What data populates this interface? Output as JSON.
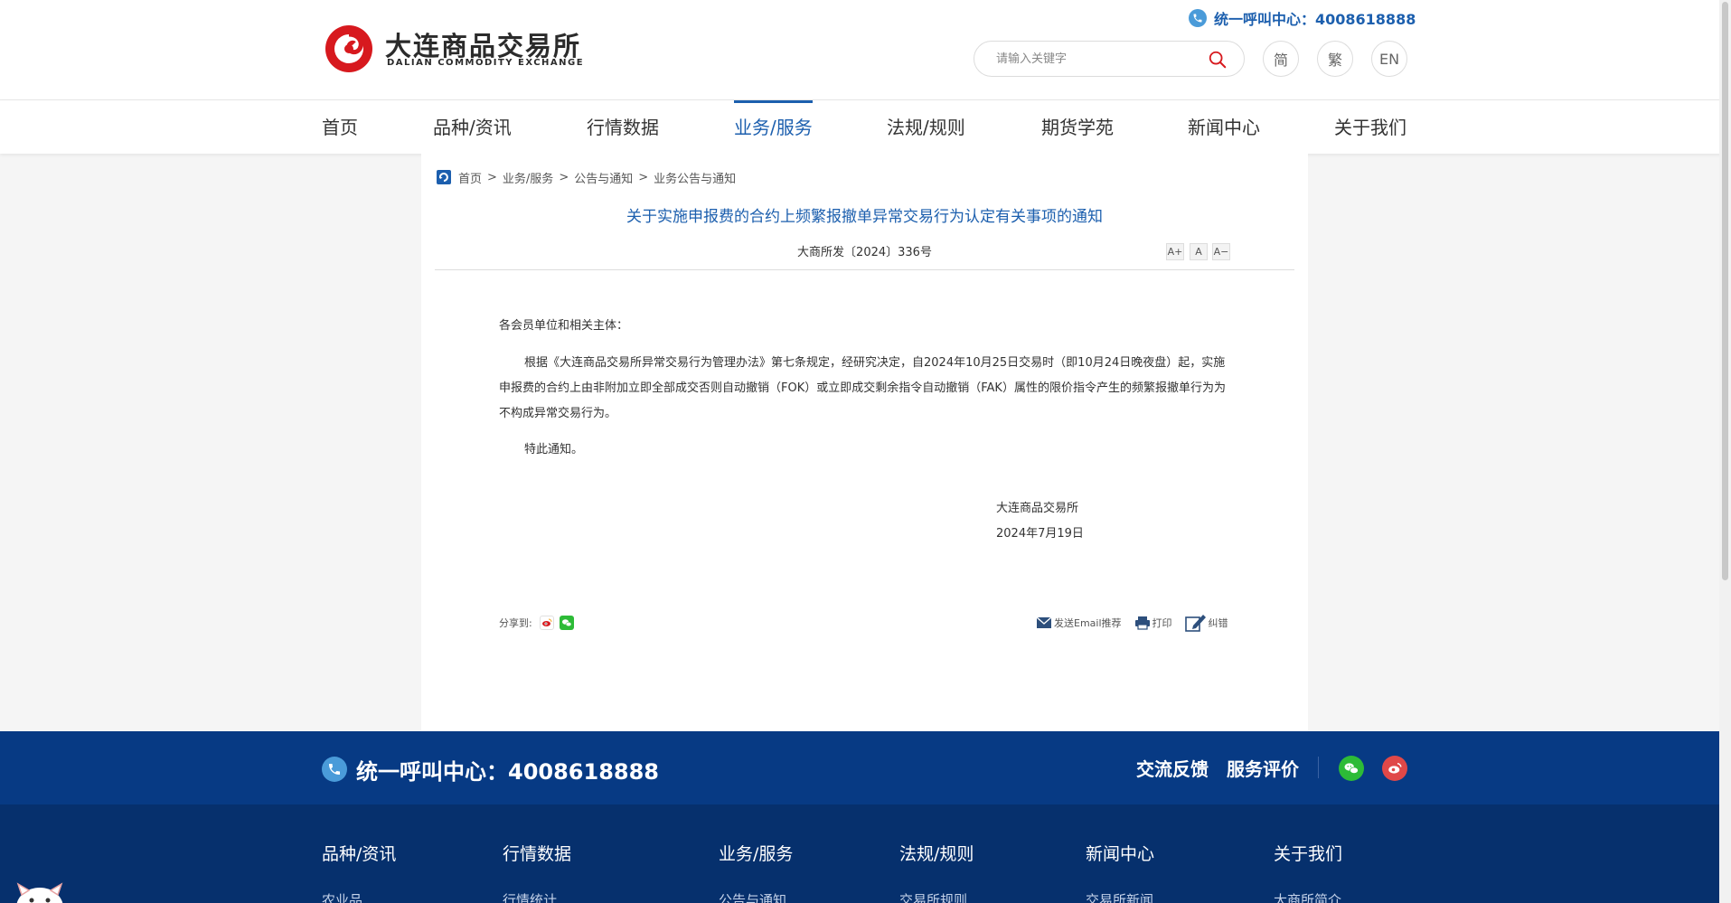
{
  "header": {
    "logo_cn": "大连商品交易所",
    "logo_en": "DALIAN COMMODITY EXCHANGE",
    "hotline": "统一呼叫中心：4008618888",
    "search_placeholder": "请输入关键字",
    "lang_simplified": "简",
    "lang_traditional": "繁",
    "lang_english": "EN"
  },
  "nav": {
    "items": [
      {
        "label": "首页"
      },
      {
        "label": "品种/资讯"
      },
      {
        "label": "行情数据"
      },
      {
        "label": "业务/服务",
        "active": true
      },
      {
        "label": "法规/规则"
      },
      {
        "label": "期货学苑"
      },
      {
        "label": "新闻中心"
      },
      {
        "label": "关于我们"
      }
    ]
  },
  "breadcrumb": {
    "items": [
      "首页",
      "业务/服务",
      "公告与通知",
      "业务公告与通知"
    ],
    "separator": ">"
  },
  "article": {
    "title": "关于实施申报费的合约上频繁报撤单异常交易行为认定有关事项的通知",
    "doc_number": "大商所发〔2024〕336号",
    "font_larger": "A+",
    "font_normal": "A",
    "font_smaller": "A−",
    "salutation": "各会员单位和相关主体：",
    "paragraph": "根据《大连商品交易所异常交易行为管理办法》第七条规定，经研究决定，自2024年10月25日交易时（即10月24日晚夜盘）起，实施申报费的合约上由非附加立即全部成交否则自动撤销（FOK）或立即成交剩余指令自动撤销（FAK）属性的限价指令产生的频繁报撤单行为为不构成异常交易行为。",
    "closing": "特此通知。",
    "signature_org": "大连商品交易所",
    "signature_date": "2024年7月19日"
  },
  "share": {
    "label": "分享到:",
    "weibo_glyph": "微",
    "wechat_glyph": "信"
  },
  "tools": {
    "email": "发送Email推荐",
    "print": "打印",
    "report_error": "纠错"
  },
  "footer_bar": {
    "hotline": "统一呼叫中心：4008618888",
    "feedback": "交流反馈",
    "service_rating": "服务评价"
  },
  "footer": {
    "columns": [
      {
        "heading": "品种/资讯",
        "first_link": "农业品"
      },
      {
        "heading": "行情数据",
        "first_link": "行情统计"
      },
      {
        "heading": "业务/服务",
        "first_link": "公告与通知"
      },
      {
        "heading": "法规/规则",
        "first_link": "交易所规则"
      },
      {
        "heading": "新闻中心",
        "first_link": "交易所新闻"
      },
      {
        "heading": "关于我们",
        "first_link": "大商所简介"
      }
    ]
  },
  "colors": {
    "brand_blue": "#1c5fae",
    "logo_red": "#d7191e",
    "footer_bar": "#073a84",
    "footer": "#06306d"
  }
}
